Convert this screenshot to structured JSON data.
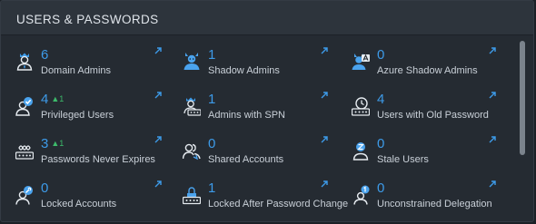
{
  "panel": {
    "title": "USERS & PASSWORDS"
  },
  "tiles": [
    {
      "count": "6",
      "trend": "",
      "label": "Domain Admins",
      "icon": "domain-admin-icon"
    },
    {
      "count": "1",
      "trend": "",
      "label": "Shadow Admins",
      "icon": "shadow-admin-icon"
    },
    {
      "count": "0",
      "trend": "",
      "label": "Azure Shadow Admins",
      "icon": "azure-admin-icon"
    },
    {
      "count": "4",
      "trend": "▲1",
      "label": "Privileged Users",
      "icon": "privileged-user-icon"
    },
    {
      "count": "1",
      "trend": "",
      "label": "Admins with SPN",
      "icon": "admin-spn-icon"
    },
    {
      "count": "4",
      "trend": "",
      "label": "Users with Old Password",
      "icon": "old-password-icon"
    },
    {
      "count": "3",
      "trend": "▲1",
      "label": "Passwords Never Expires",
      "icon": "password-never-expires-icon"
    },
    {
      "count": "0",
      "trend": "",
      "label": "Shared Accounts",
      "icon": "shared-accounts-icon"
    },
    {
      "count": "0",
      "trend": "",
      "label": "Stale Users",
      "icon": "stale-user-icon"
    },
    {
      "count": "0",
      "trend": "",
      "label": "Locked Accounts",
      "icon": "locked-account-icon"
    },
    {
      "count": "1",
      "trend": "",
      "label": "Locked After Password Change",
      "icon": "locked-after-password-change-icon"
    },
    {
      "count": "0",
      "trend": "",
      "label": "Unconstrained Delegation",
      "icon": "unconstrained-delegation-icon"
    }
  ],
  "colors": {
    "count": "#3d9be9",
    "trend_up": "#3dbb6b",
    "label": "#c9d0d8",
    "panel_bg": "#252b32",
    "header_bg": "#2d343c"
  }
}
